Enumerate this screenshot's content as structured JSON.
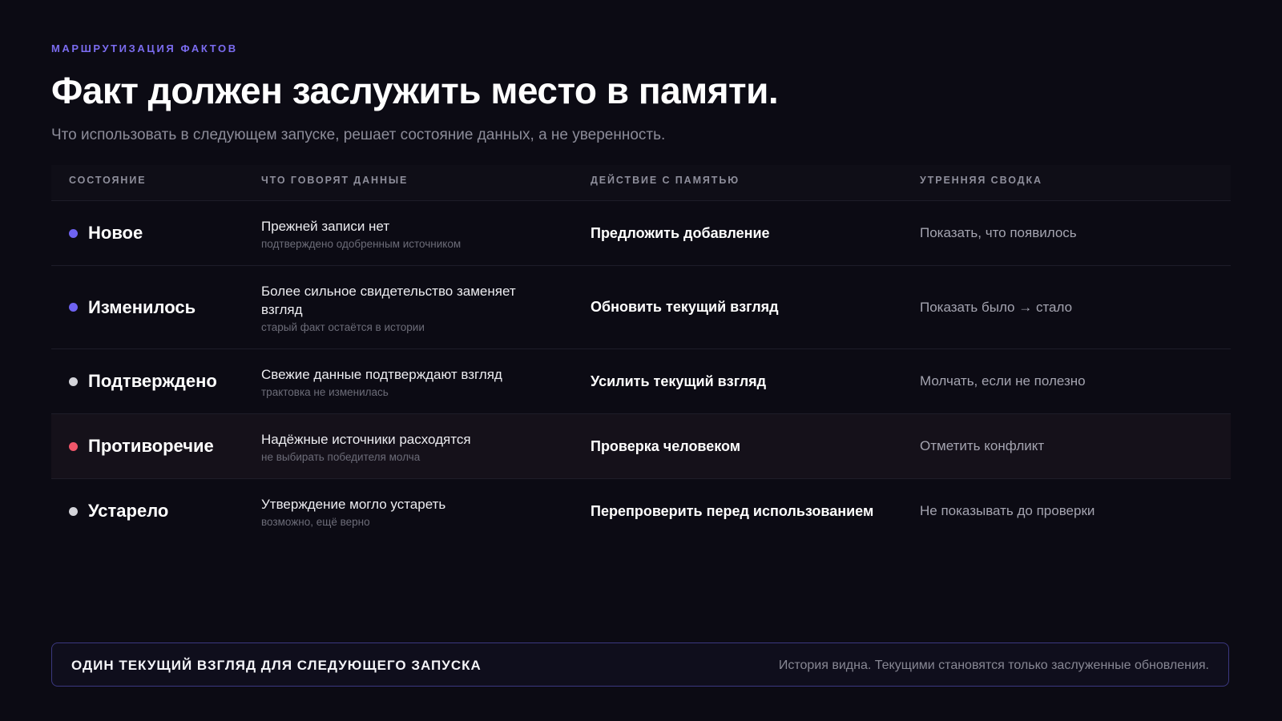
{
  "header": {
    "eyebrow": "МАРШРУТИЗАЦИЯ ФАКТОВ",
    "title": "Факт должен заслужить место в памяти.",
    "subtitle": "Что использовать в следующем запуске, решает состояние данных, а не уверенность."
  },
  "table": {
    "columns": [
      "СОСТОЯНИЕ",
      "ЧТО ГОВОРЯТ ДАННЫЕ",
      "ДЕЙСТВИЕ С ПАМЯТЬЮ",
      "УТРЕННЯЯ СВОДКА"
    ],
    "rows": [
      {
        "state": "Новое",
        "dot_color": "#6f63f2",
        "data_main": "Прежней записи нет",
        "data_sub": "подтверждено одобренным источником",
        "action": "Предложить добавление",
        "brief": "Показать, что появилось"
      },
      {
        "state": "Изменилось",
        "dot_color": "#6f63f2",
        "data_main": "Более сильное свидетельство заменяет взгляд",
        "data_sub": "старый факт остаётся в истории",
        "action": "Обновить текущий взгляд",
        "brief": "Показать было → стало"
      },
      {
        "state": "Подтверждено",
        "dot_color": "#d4d4da",
        "data_main": "Свежие данные подтверждают взгляд",
        "data_sub": "трактовка не изменилась",
        "action": "Усилить текущий взгляд",
        "brief": "Молчать, если не полезно"
      },
      {
        "state": "Противоречие",
        "dot_color": "#f0566a",
        "data_main": "Надёжные источники расходятся",
        "data_sub": "не выбирать победителя молча",
        "action": "Проверка человеком",
        "brief": "Отметить конфликт"
      },
      {
        "state": "Устарело",
        "dot_color": "#d4d4da",
        "data_main": "Утверждение могло устареть",
        "data_sub": "возможно, ещё верно",
        "action": "Перепроверить перед использованием",
        "brief": "Не показывать до проверки"
      }
    ]
  },
  "footer": {
    "title": "ОДИН ТЕКУЩИЙ ВЗГЛЯД ДЛЯ СЛЕДУЮЩЕГО ЗАПУСКА",
    "note": "История видна. Текущими становятся только заслуженные обновления."
  },
  "colors": {
    "background": "#0c0b14",
    "accent": "#7b6cf0",
    "conflict": "#f0566a",
    "neutral": "#d4d4da"
  }
}
